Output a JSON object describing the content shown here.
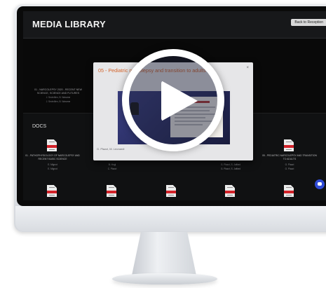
{
  "app": {
    "title": "MEDIA LIBRARY",
    "back_button": "Back to Reception"
  },
  "video_cards": [
    {
      "title": "01 - NARCOLEPSY 2020 - RECENT NEW SCIENCE, SCIENCE AND FUTURES",
      "authors": [
        "J. Sevinillen, B. Warame",
        "J. Sevinillen, B. Warame"
      ]
    }
  ],
  "modal": {
    "title": "05 - Pediatric narcolepsy and transition to adults",
    "close": "×",
    "authors": "G. Plazzi, M. Leonardi"
  },
  "docs": {
    "heading": "DOCS",
    "cards": [
      {
        "title": "01 - PATHOPHYSIOLOGY OF NARCOLEPSY AND RECENT BASIC SCIENCE",
        "authors": [
          "E. Mignot",
          "E. Mignot"
        ]
      },
      {
        "title": "02 - DIAGNOSIS",
        "authors": [
          "B. Hogl",
          "C. Plazzi"
        ]
      },
      {
        "title": "",
        "authors": []
      },
      {
        "title": "",
        "authors": [
          "G. Plazzi, S. Jaffard",
          "G. Plazzi, S. Jaffard"
        ]
      },
      {
        "title": "05 - PEDIATRIC NARCOLEPSY AND TRANSITION TO ADULTS",
        "authors": [
          "G. Plazzi",
          "G. Plazzi"
        ]
      }
    ]
  },
  "icons": {
    "pdf": "pdf-file-icon",
    "play": "play-icon",
    "chat": "chat-icon"
  },
  "colors": {
    "accent": "#d4632a",
    "chat": "#2f4bd6",
    "pdf_band": "#d2232a"
  }
}
